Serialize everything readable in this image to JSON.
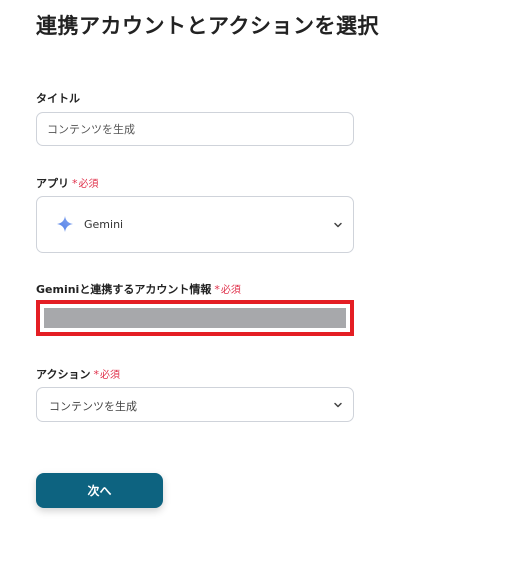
{
  "page": {
    "title": "連携アカウントとアクションを選択"
  },
  "title_field": {
    "label": "タイトル",
    "value": "コンテンツを生成"
  },
  "app_field": {
    "label": "アプリ",
    "required_text": "必須",
    "selected_app": "Gemini",
    "icon": "gemini-sparkle-icon"
  },
  "account_field": {
    "label": "Geminiと連携するアカウント情報",
    "required_text": "必須",
    "value_redacted": true
  },
  "action_field": {
    "label": "アクション",
    "required_text": "必須",
    "selected_action": "コンテンツを生成"
  },
  "buttons": {
    "next_label": "次へ"
  },
  "colors": {
    "required": "#e0314b",
    "primary_button": "#0d6380",
    "highlight_border": "#e41e24",
    "redacted_fill": "#a7a8ab"
  }
}
